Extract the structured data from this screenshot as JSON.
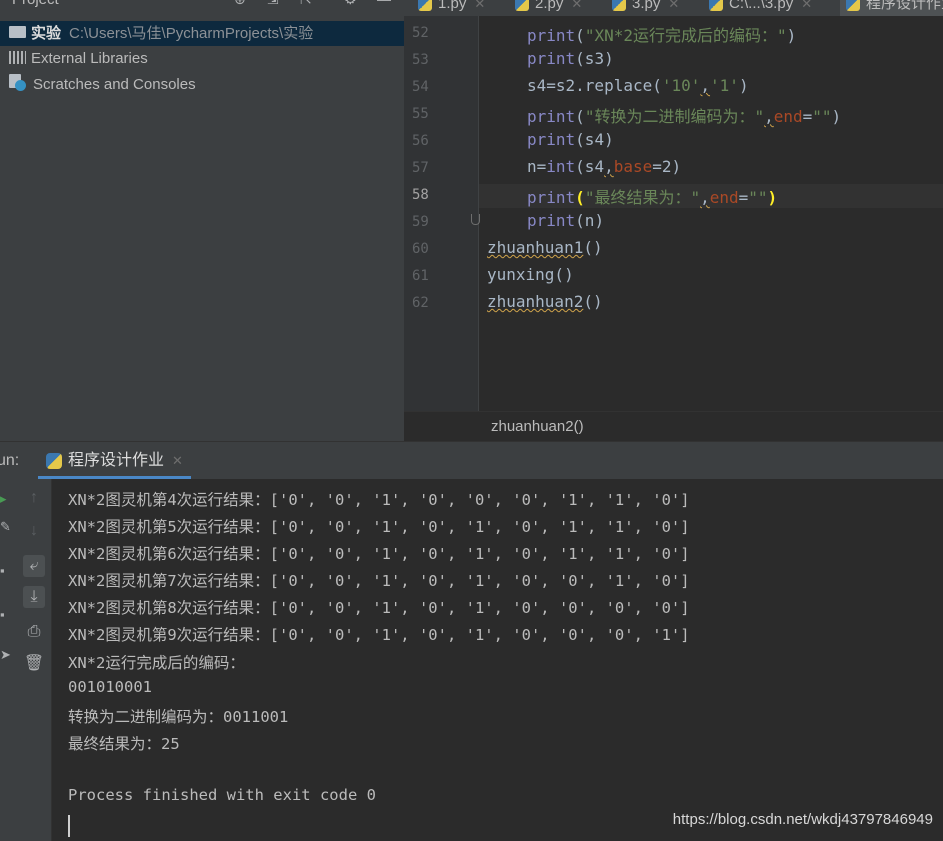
{
  "project": {
    "title": "Project",
    "tree": [
      {
        "label": "实验",
        "path": "C:\\Users\\马佳\\PycharmProjects\\实验",
        "icon": "folder-icon"
      },
      {
        "label": "External Libraries",
        "icon": "library-icon"
      },
      {
        "label": "Scratches and Consoles",
        "icon": "scratches-icon"
      }
    ]
  },
  "tabs": [
    {
      "label": "1.py"
    },
    {
      "label": "2.py"
    },
    {
      "label": "3.py"
    },
    {
      "label": "C:\\...\\3.py"
    },
    {
      "label": "程序设计作业"
    }
  ],
  "editor": {
    "line_numbers": [
      "52",
      "53",
      "54",
      "55",
      "56",
      "57",
      "58",
      "59",
      "60",
      "61",
      "62"
    ],
    "current_line": "58",
    "code": [
      "print(\"XN*2运行完成后的编码：\")",
      "print(s3)",
      "s4=s2.replace('10','1')",
      "print(\"转换为二进制编码为：\",end=\"\")",
      "print(s4)",
      "n=int(s4,base=2)",
      "print(\"最终结果为：\",end=\"\")",
      "print(n)",
      "zhuanhuan1()",
      "yunxing()",
      "zhuanhuan2()"
    ],
    "breadcrumb": "zhuanhuan2()"
  },
  "run": {
    "label": "un:",
    "tab_label": "程序设计作业",
    "output": [
      "XN*2图灵机第4次运行结果：['0', '0', '1', '0', '0', '0', '1', '1', '0']",
      "XN*2图灵机第5次运行结果：['0', '0', '1', '0', '1', '0', '1', '1', '0']",
      "XN*2图灵机第6次运行结果：['0', '0', '1', '0', '1', '0', '1', '1', '0']",
      "XN*2图灵机第7次运行结果：['0', '0', '1', '0', '1', '0', '0', '1', '0']",
      "XN*2图灵机第8次运行结果：['0', '0', '1', '0', '1', '0', '0', '0', '0']",
      "XN*2图灵机第9次运行结果：['0', '0', '1', '0', '1', '0', '0', '0', '1']",
      "XN*2运行完成后的编码：",
      "001010001",
      "转换为二进制编码为：0011001",
      "最终结果为：25",
      "",
      "Process finished with exit code 0"
    ]
  },
  "watermark": "https://blog.csdn.net/wkdj43797846949",
  "colors": {
    "background": "#2b2b2b",
    "panel": "#3c3f41",
    "selection": "#0d293e",
    "function": "#8888c6",
    "string": "#6a8759",
    "keyword_arg": "#aa4926",
    "text": "#a9b7c6"
  }
}
